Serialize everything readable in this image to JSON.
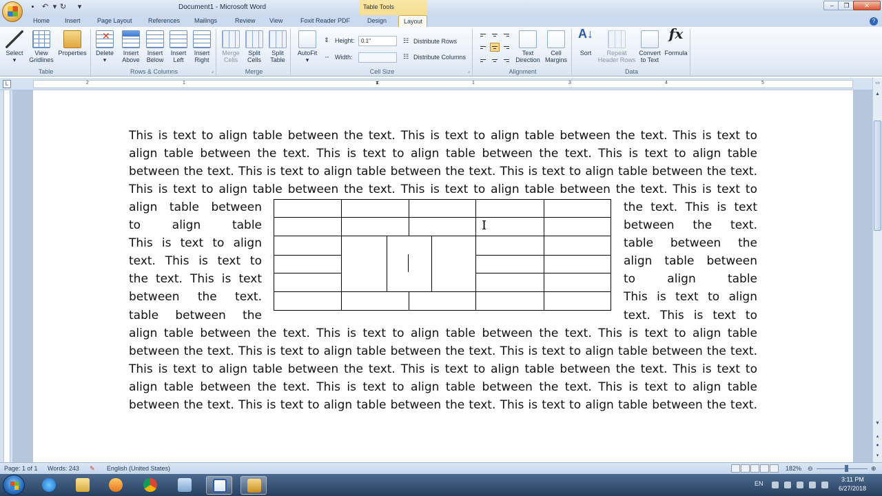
{
  "window": {
    "title": "Document1 - Microsoft Word",
    "context_group": "Table Tools"
  },
  "tabs": [
    "Home",
    "Insert",
    "Page Layout",
    "References",
    "Mailings",
    "Review",
    "View",
    "Foxit Reader PDF",
    "Design",
    "Layout"
  ],
  "active_tab": "Layout",
  "ribbon": {
    "table_group": {
      "label": "Table",
      "select": "Select",
      "gridlines_1": "View",
      "gridlines_2": "Gridlines",
      "properties": "Properties"
    },
    "rows_cols_group": {
      "label": "Rows & Columns",
      "delete": "Delete",
      "above_1": "Insert",
      "above_2": "Above",
      "below_1": "Insert",
      "below_2": "Below",
      "left_1": "Insert",
      "left_2": "Left",
      "right_1": "Insert",
      "right_2": "Right"
    },
    "merge_group": {
      "label": "Merge",
      "merge_1": "Merge",
      "merge_2": "Cells",
      "split_1": "Split",
      "split_2": "Cells",
      "splitt_1": "Split",
      "splitt_2": "Table"
    },
    "cell_size_group": {
      "label": "Cell Size",
      "autofit": "AutoFit",
      "height_label": "Height:",
      "height_value": "0.1\"",
      "width_label": "Width:",
      "width_value": "",
      "dist_rows": "Distribute Rows",
      "dist_cols": "Distribute Columns"
    },
    "alignment_group": {
      "label": "Alignment",
      "dir_1": "Text",
      "dir_2": "Direction",
      "margins_1": "Cell",
      "margins_2": "Margins"
    },
    "data_group": {
      "label": "Data",
      "sort": "Sort",
      "repeat_1": "Repeat",
      "repeat_2": "Header Rows",
      "convert_1": "Convert",
      "convert_2": "to Text",
      "formula": "Formula"
    }
  },
  "ruler": {
    "numbers": [
      "2",
      "1",
      "1",
      "2",
      "3",
      "4",
      "5"
    ]
  },
  "document": {
    "top_lines": [
      "This is text to align table between the text. This is text to align table between the text. This is text to",
      "align table between the text. This is text to align table between the text. This is text to align table",
      "between the text. This is text to align table between the text. This is text to align table between the text.",
      "This is text to align table between the text. This is text to align table between the text. This is text to"
    ],
    "left_lines": [
      "align table between",
      "to align table",
      "This is text to align",
      "text. This is text to",
      "the text. This is text",
      "between the text.",
      "table between the"
    ],
    "right_lines": [
      "the text. This is text",
      "between the text.",
      "table between the",
      "align table between",
      "to align table",
      "This is text to align",
      "text. This is text to"
    ],
    "bottom_lines": [
      "align table between the text. This is text to align table between the text. This is text to align table",
      "between the text. This is text to align table between the text. This is text to align table between the text.",
      "This is text to align table between the text. This is text to align table between the text. This is text to",
      "align table between the text. This is text to align table between the text. This is text to align table",
      "between the text. This is text to align table between the text. This is text to align table between the text."
    ]
  },
  "status": {
    "page": "Page: 1 of 1",
    "words": "Words: 243",
    "language": "English (United States)",
    "zoom": "182%"
  },
  "taskbar": {
    "language": "EN",
    "time": "3:11 PM",
    "date": "6/27/2018"
  }
}
